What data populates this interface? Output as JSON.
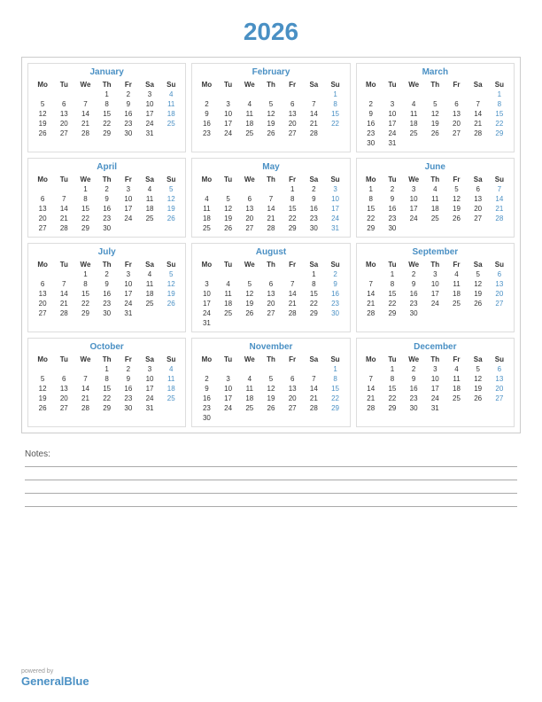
{
  "year": "2026",
  "months": [
    {
      "name": "January",
      "days": [
        [
          "",
          "",
          "",
          "1",
          "2",
          "3",
          "4"
        ],
        [
          "5",
          "6",
          "7",
          "8",
          "9",
          "10",
          "11"
        ],
        [
          "12",
          "13",
          "14",
          "15",
          "16",
          "17",
          "18"
        ],
        [
          "19",
          "20",
          "21",
          "22",
          "23",
          "24",
          "25"
        ],
        [
          "26",
          "27",
          "28",
          "29",
          "30",
          "31",
          ""
        ]
      ]
    },
    {
      "name": "February",
      "days": [
        [
          "",
          "",
          "",
          "",
          "",
          "",
          "1"
        ],
        [
          "2",
          "3",
          "4",
          "5",
          "6",
          "7",
          "8"
        ],
        [
          "9",
          "10",
          "11",
          "12",
          "13",
          "14",
          "15"
        ],
        [
          "16",
          "17",
          "18",
          "19",
          "20",
          "21",
          "22"
        ],
        [
          "23",
          "24",
          "25",
          "26",
          "27",
          "28",
          ""
        ]
      ]
    },
    {
      "name": "March",
      "days": [
        [
          "",
          "",
          "",
          "",
          "",
          "",
          "1"
        ],
        [
          "2",
          "3",
          "4",
          "5",
          "6",
          "7",
          "8"
        ],
        [
          "9",
          "10",
          "11",
          "12",
          "13",
          "14",
          "15"
        ],
        [
          "16",
          "17",
          "18",
          "19",
          "20",
          "21",
          "22"
        ],
        [
          "23",
          "24",
          "25",
          "26",
          "27",
          "28",
          "29"
        ],
        [
          "30",
          "31",
          "",
          "",
          "",
          "",
          ""
        ]
      ]
    },
    {
      "name": "April",
      "days": [
        [
          "",
          "",
          "1",
          "2",
          "3",
          "4",
          "5"
        ],
        [
          "6",
          "7",
          "8",
          "9",
          "10",
          "11",
          "12"
        ],
        [
          "13",
          "14",
          "15",
          "16",
          "17",
          "18",
          "19"
        ],
        [
          "20",
          "21",
          "22",
          "23",
          "24",
          "25",
          "26"
        ],
        [
          "27",
          "28",
          "29",
          "30",
          "",
          "",
          ""
        ]
      ]
    },
    {
      "name": "May",
      "days": [
        [
          "",
          "",
          "",
          "",
          "1",
          "2",
          "3"
        ],
        [
          "4",
          "5",
          "6",
          "7",
          "8",
          "9",
          "10"
        ],
        [
          "11",
          "12",
          "13",
          "14",
          "15",
          "16",
          "17"
        ],
        [
          "18",
          "19",
          "20",
          "21",
          "22",
          "23",
          "24"
        ],
        [
          "25",
          "26",
          "27",
          "28",
          "29",
          "30",
          "31"
        ]
      ]
    },
    {
      "name": "June",
      "days": [
        [
          "1",
          "2",
          "3",
          "4",
          "5",
          "6",
          "7"
        ],
        [
          "8",
          "9",
          "10",
          "11",
          "12",
          "13",
          "14"
        ],
        [
          "15",
          "16",
          "17",
          "18",
          "19",
          "20",
          "21"
        ],
        [
          "22",
          "23",
          "24",
          "25",
          "26",
          "27",
          "28"
        ],
        [
          "29",
          "30",
          "",
          "",
          "",
          "",
          ""
        ]
      ]
    },
    {
      "name": "July",
      "days": [
        [
          "",
          "",
          "1",
          "2",
          "3",
          "4",
          "5"
        ],
        [
          "6",
          "7",
          "8",
          "9",
          "10",
          "11",
          "12"
        ],
        [
          "13",
          "14",
          "15",
          "16",
          "17",
          "18",
          "19"
        ],
        [
          "20",
          "21",
          "22",
          "23",
          "24",
          "25",
          "26"
        ],
        [
          "27",
          "28",
          "29",
          "30",
          "31",
          "",
          ""
        ]
      ]
    },
    {
      "name": "August",
      "days": [
        [
          "",
          "",
          "",
          "",
          "",
          "1",
          "2"
        ],
        [
          "3",
          "4",
          "5",
          "6",
          "7",
          "8",
          "9"
        ],
        [
          "10",
          "11",
          "12",
          "13",
          "14",
          "15",
          "16"
        ],
        [
          "17",
          "18",
          "19",
          "20",
          "21",
          "22",
          "23"
        ],
        [
          "24",
          "25",
          "26",
          "27",
          "28",
          "29",
          "30"
        ],
        [
          "31",
          "",
          "",
          "",
          "",
          "",
          ""
        ]
      ]
    },
    {
      "name": "September",
      "days": [
        [
          "",
          "1",
          "2",
          "3",
          "4",
          "5",
          "6"
        ],
        [
          "7",
          "8",
          "9",
          "10",
          "11",
          "12",
          "13"
        ],
        [
          "14",
          "15",
          "16",
          "17",
          "18",
          "19",
          "20"
        ],
        [
          "21",
          "22",
          "23",
          "24",
          "25",
          "26",
          "27"
        ],
        [
          "28",
          "29",
          "30",
          "",
          "",
          "",
          ""
        ]
      ]
    },
    {
      "name": "October",
      "days": [
        [
          "",
          "",
          "",
          "1",
          "2",
          "3",
          "4"
        ],
        [
          "5",
          "6",
          "7",
          "8",
          "9",
          "10",
          "11"
        ],
        [
          "12",
          "13",
          "14",
          "15",
          "16",
          "17",
          "18"
        ],
        [
          "19",
          "20",
          "21",
          "22",
          "23",
          "24",
          "25"
        ],
        [
          "26",
          "27",
          "28",
          "29",
          "30",
          "31",
          ""
        ]
      ]
    },
    {
      "name": "November",
      "days": [
        [
          "",
          "",
          "",
          "",
          "",
          "",
          "1"
        ],
        [
          "2",
          "3",
          "4",
          "5",
          "6",
          "7",
          "8"
        ],
        [
          "9",
          "10",
          "11",
          "12",
          "13",
          "14",
          "15"
        ],
        [
          "16",
          "17",
          "18",
          "19",
          "20",
          "21",
          "22"
        ],
        [
          "23",
          "24",
          "25",
          "26",
          "27",
          "28",
          "29"
        ],
        [
          "30",
          "",
          "",
          "",
          "",
          "",
          ""
        ]
      ]
    },
    {
      "name": "December",
      "days": [
        [
          "",
          "1",
          "2",
          "3",
          "4",
          "5",
          "6"
        ],
        [
          "7",
          "8",
          "9",
          "10",
          "11",
          "12",
          "13"
        ],
        [
          "14",
          "15",
          "16",
          "17",
          "18",
          "19",
          "20"
        ],
        [
          "21",
          "22",
          "23",
          "24",
          "25",
          "26",
          "27"
        ],
        [
          "28",
          "29",
          "30",
          "31",
          "",
          "",
          ""
        ]
      ]
    }
  ],
  "weekdays": [
    "Mo",
    "Tu",
    "We",
    "Th",
    "Fr",
    "Sa",
    "Su"
  ],
  "notes_label": "Notes:",
  "footer_powered": "powered by",
  "footer_brand_black": "General",
  "footer_brand_blue": "Blue"
}
